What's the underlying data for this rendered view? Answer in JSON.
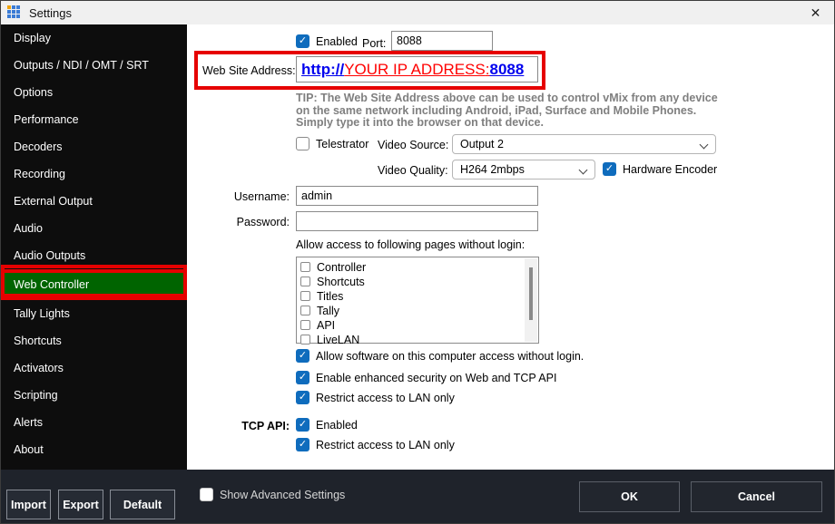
{
  "window": {
    "title": "Settings",
    "close": "✕"
  },
  "sidebar": {
    "items": [
      "Display",
      "Outputs / NDI / OMT / SRT",
      "Options",
      "Performance",
      "Decoders",
      "Recording",
      "External Output",
      "Audio",
      "Audio Outputs",
      "Web Controller",
      "Tally Lights",
      "Shortcuts",
      "Activators",
      "Scripting",
      "Alerts",
      "About"
    ],
    "active_item": "Web Controller",
    "buttons": {
      "import": "Import",
      "export": "Export",
      "default": "Default"
    }
  },
  "content": {
    "enabled_row": {
      "enabled": "Enabled",
      "port_label": "Port:",
      "port_value": "8088"
    },
    "website": {
      "label": "Web Site Address:",
      "http": "http://",
      "ip": "YOUR IP ADDRESS",
      "colon": ":",
      "port": "8088"
    },
    "tip": {
      "line1": "TIP: The Web Site Address above can be used to control vMix from any device",
      "line2": "on the same network including Android, iPad, Surface and Mobile Phones.",
      "line3": "Simply type it into the browser on that device."
    },
    "telestrator": {
      "label": "Telestrator",
      "video_source_label": "Video Source:",
      "video_source_value": "Output 2",
      "video_quality_label": "Video Quality:",
      "video_quality_value": "H264 2mbps",
      "hardware_encoder": "Hardware Encoder"
    },
    "login": {
      "username_label": "Username:",
      "username_value": "admin",
      "password_label": "Password:",
      "password_value": ""
    },
    "listbox": {
      "label": "Allow access to following pages without login:",
      "items": [
        "Controller",
        "Shortcuts",
        "Titles",
        "Tally",
        "API",
        "LiveLAN"
      ]
    },
    "checks": {
      "software": "Allow software on this computer access without login.",
      "enhanced": "Enable enhanced security on Web and TCP API",
      "restrict_web": "Restrict access to LAN only",
      "tcp_label": "TCP API:",
      "tcp_enabled": "Enabled",
      "restrict_tcp": "Restrict access to LAN only"
    }
  },
  "footer": {
    "show_advanced": "Show Advanced Settings",
    "ok": "OK",
    "cancel": "Cancel"
  }
}
